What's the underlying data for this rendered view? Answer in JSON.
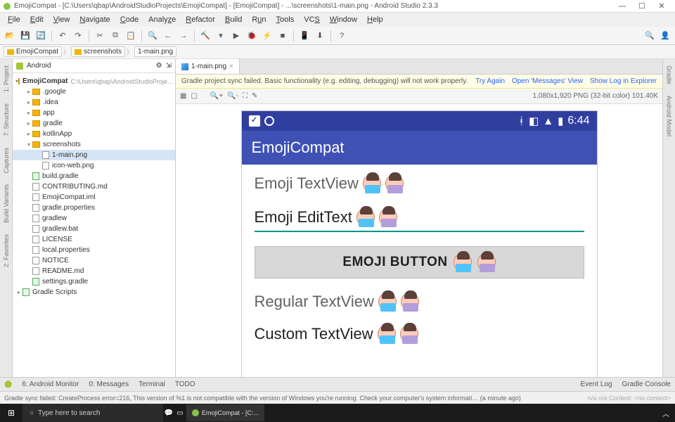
{
  "window": {
    "title": "EmojiCompat - [C:\\Users\\qbap\\AndroidStudioProjects\\EmojiCompat] - [EmojiCompat] - ...\\screenshots\\1-main.png - Android Studio 2.3.3",
    "min": "—",
    "max": "☐",
    "close": "✕"
  },
  "menu": [
    "File",
    "Edit",
    "View",
    "Navigate",
    "Code",
    "Analyze",
    "Refactor",
    "Build",
    "Run",
    "Tools",
    "VCS",
    "Window",
    "Help"
  ],
  "breadcrumbs": [
    "EmojiCompat",
    "screenshots",
    "1-main.png"
  ],
  "left_gutter": [
    "1: Project",
    "7: Structure",
    "Captures",
    "Build Variants",
    "2: Favorites"
  ],
  "right_gutter": [
    "Gradle",
    "Android Model"
  ],
  "tree": {
    "header_mode": "Android",
    "root": "EmojiCompat",
    "root_sub": "C:\\Users\\qbap\\AndroidStudioProje…",
    "items": [
      {
        "indent": 1,
        "arr": "▸",
        "type": "fold",
        "label": ".google"
      },
      {
        "indent": 1,
        "arr": "▸",
        "type": "fold",
        "label": ".idea"
      },
      {
        "indent": 1,
        "arr": "▸",
        "type": "fold",
        "label": "app"
      },
      {
        "indent": 1,
        "arr": "▸",
        "type": "fold",
        "label": "gradle"
      },
      {
        "indent": 1,
        "arr": "▸",
        "type": "fold",
        "label": "kotlinApp"
      },
      {
        "indent": 1,
        "arr": "▾",
        "type": "fold",
        "label": "screenshots"
      },
      {
        "indent": 2,
        "arr": "",
        "type": "file",
        "label": "1-main.png",
        "sel": true
      },
      {
        "indent": 2,
        "arr": "",
        "type": "file",
        "label": "icon-web.png"
      },
      {
        "indent": 1,
        "arr": "",
        "type": "gr",
        "label": "build.gradle"
      },
      {
        "indent": 1,
        "arr": "",
        "type": "file",
        "label": "CONTRIBUTING.md"
      },
      {
        "indent": 1,
        "arr": "",
        "type": "file",
        "label": "EmojiCompat.iml"
      },
      {
        "indent": 1,
        "arr": "",
        "type": "file",
        "label": "gradle.properties"
      },
      {
        "indent": 1,
        "arr": "",
        "type": "file",
        "label": "gradlew"
      },
      {
        "indent": 1,
        "arr": "",
        "type": "file",
        "label": "gradlew.bat"
      },
      {
        "indent": 1,
        "arr": "",
        "type": "file",
        "label": "LICENSE"
      },
      {
        "indent": 1,
        "arr": "",
        "type": "file",
        "label": "local.properties"
      },
      {
        "indent": 1,
        "arr": "",
        "type": "file",
        "label": "NOTICE"
      },
      {
        "indent": 1,
        "arr": "",
        "type": "file",
        "label": "README.md"
      },
      {
        "indent": 1,
        "arr": "",
        "type": "gr",
        "label": "settings.gradle"
      }
    ],
    "scripts": "Gradle Scripts"
  },
  "editor": {
    "tab_label": "1-main.png",
    "notice_text": "Gradle project sync failed. Basic functionality (e.g. editing, debugging) will not work properly.",
    "notice_links": [
      "Try Again",
      "Open 'Messages' View",
      "Show Log in Explorer"
    ],
    "image_meta": "1,080x1,920 PNG (32-bit color) 101.40K"
  },
  "phone": {
    "time": "6:44",
    "app_title": "EmojiCompat",
    "tv": "Emoji TextView",
    "et": "Emoji EditText",
    "btn": "EMOJI BUTTON",
    "reg": "Regular TextView",
    "cust": "Custom TextView"
  },
  "bottom_tabs": {
    "left": [
      "6: Android Monitor",
      "0: Messages",
      "Terminal",
      "TODO"
    ],
    "right": [
      "Event Log",
      "Gradle Console"
    ]
  },
  "status_bar": {
    "msg": "Gradle sync failed: CreateProcess error=216, This version of %1 is not compatible with the version of Windows you're running. Check your computer's system informati… (a minute ago)",
    "ctx": "n/a   n/a   Context: <no context>"
  },
  "taskbar": {
    "search_placeholder": "Type here to search",
    "app": "EmojiCompat - [C:..."
  }
}
